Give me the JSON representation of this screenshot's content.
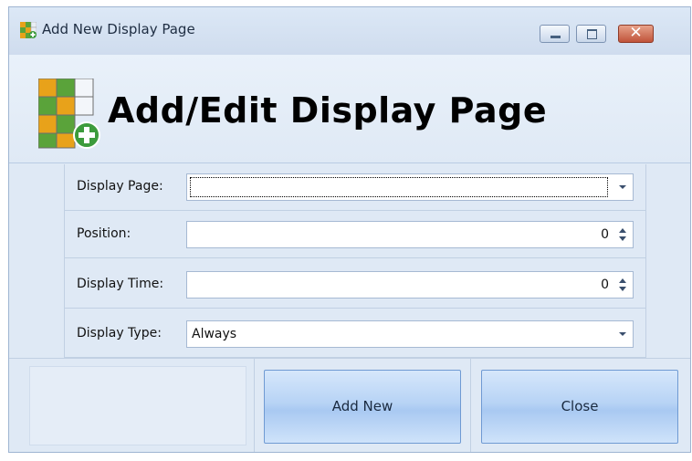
{
  "window": {
    "title": "Add New Display Page",
    "controls": [
      "minimize",
      "maximize",
      "close"
    ]
  },
  "header": {
    "title": "Add/Edit Display Page",
    "icon": "grid-add-icon"
  },
  "form": {
    "display_page": {
      "label": "Display Page:",
      "value": ""
    },
    "position": {
      "label": "Position:",
      "value": "0"
    },
    "display_time": {
      "label": "Display Time:",
      "value": "0"
    },
    "display_type": {
      "label": "Display Type:",
      "value": "Always"
    }
  },
  "buttons": {
    "add_new": "Add New",
    "close": "Close"
  },
  "colors": {
    "window_bg": "#dfe9f5",
    "button_blue": "#b7d3f5",
    "close_red": "#c0533a"
  }
}
